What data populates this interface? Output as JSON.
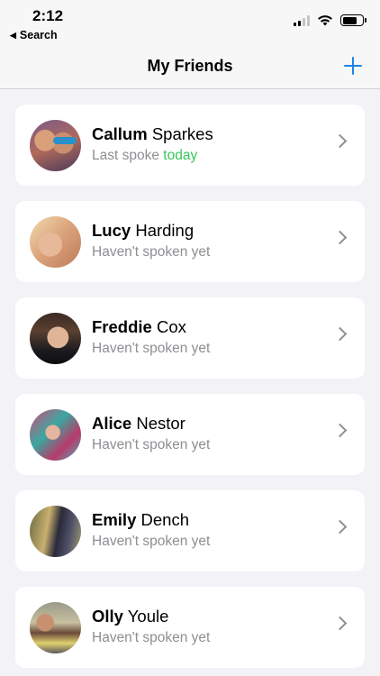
{
  "status_bar": {
    "time": "2:12",
    "back_app_label": "Search",
    "back_arrow": "◀",
    "icons": [
      "signal-icon",
      "wifi-icon",
      "battery-icon"
    ]
  },
  "nav": {
    "title": "My Friends",
    "add_icon": "plus-icon",
    "accent_color": "#1b84e8"
  },
  "friends": [
    {
      "first": "Callum",
      "last": "Sparkes",
      "status_prefix": "Last spoke ",
      "status_highlight": "today"
    },
    {
      "first": "Lucy",
      "last": "Harding",
      "status_prefix": "Haven't spoken yet",
      "status_highlight": ""
    },
    {
      "first": "Freddie",
      "last": "Cox",
      "status_prefix": "Haven't spoken yet",
      "status_highlight": ""
    },
    {
      "first": "Alice",
      "last": "Nestor",
      "status_prefix": "Haven't spoken yet",
      "status_highlight": ""
    },
    {
      "first": "Emily",
      "last": "Dench",
      "status_prefix": "Haven't spoken yet",
      "status_highlight": ""
    },
    {
      "first": "Olly",
      "last": "Youle",
      "status_prefix": "Haven't spoken yet",
      "status_highlight": ""
    }
  ],
  "colors": {
    "highlight_green": "#34c759",
    "secondary_text": "#8e8e93",
    "background": "#f2f2f7"
  }
}
